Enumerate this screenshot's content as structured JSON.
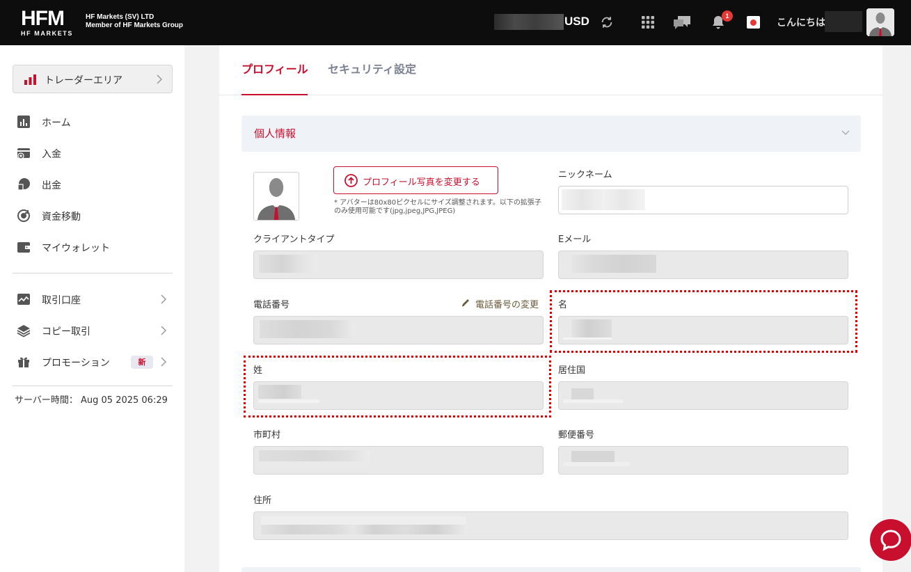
{
  "header": {
    "logo_text": "HFM",
    "logo_sub": "HF MARKETS",
    "company_line1": "HF Markets (SV) LTD",
    "company_line2": "Member of HF Markets Group",
    "currency": "USD",
    "notification_count": "1",
    "greeting": "こんにちは",
    "icons": [
      "refresh-icon",
      "apps-grid-icon",
      "chat-icon",
      "bell-icon",
      "japan-flag-icon",
      "avatar"
    ]
  },
  "sidebar": {
    "trader_area": "トレーダーエリア",
    "items": [
      {
        "label": "ホーム",
        "icon": "chart-icon"
      },
      {
        "label": "入金",
        "icon": "deposit-icon"
      },
      {
        "label": "出金",
        "icon": "withdraw-icon"
      },
      {
        "label": "資金移動",
        "icon": "transfer-icon"
      },
      {
        "label": "マイウォレット",
        "icon": "wallet-icon"
      },
      {
        "label": "取引口座",
        "icon": "trading-account-icon"
      },
      {
        "label": "コピー取引",
        "icon": "layers-icon"
      },
      {
        "label": "プロモーション",
        "icon": "gift-icon",
        "badge": "新"
      }
    ],
    "server_time": "サーバー時間： Aug 05 2025 06:29"
  },
  "tabs": {
    "profile": "プロフィール",
    "security": "セキュリティ設定"
  },
  "personal_info": {
    "title": "個人情報",
    "upload_button": "プロフィール写真を変更する",
    "avatar_note": "* アバターは80x80ピクセルにサイズ調整されます。以下の拡張子のみ使用可能です(jpg,jpeg,JPG,JPEG)",
    "labels": {
      "nickname": "ニックネーム",
      "client_type": "クライアントタイプ",
      "email": "Eメール",
      "phone": "電話番号",
      "phone_change": "電話番号の変更",
      "first_name": "名",
      "last_name": "姓",
      "country": "居住国",
      "city": "市町村",
      "postal_code": "郵便番号",
      "address": "住所"
    }
  },
  "colors": {
    "brand_red": "#c8102e",
    "header_bg": "#0d0d0d",
    "highlight": "#e00000"
  }
}
